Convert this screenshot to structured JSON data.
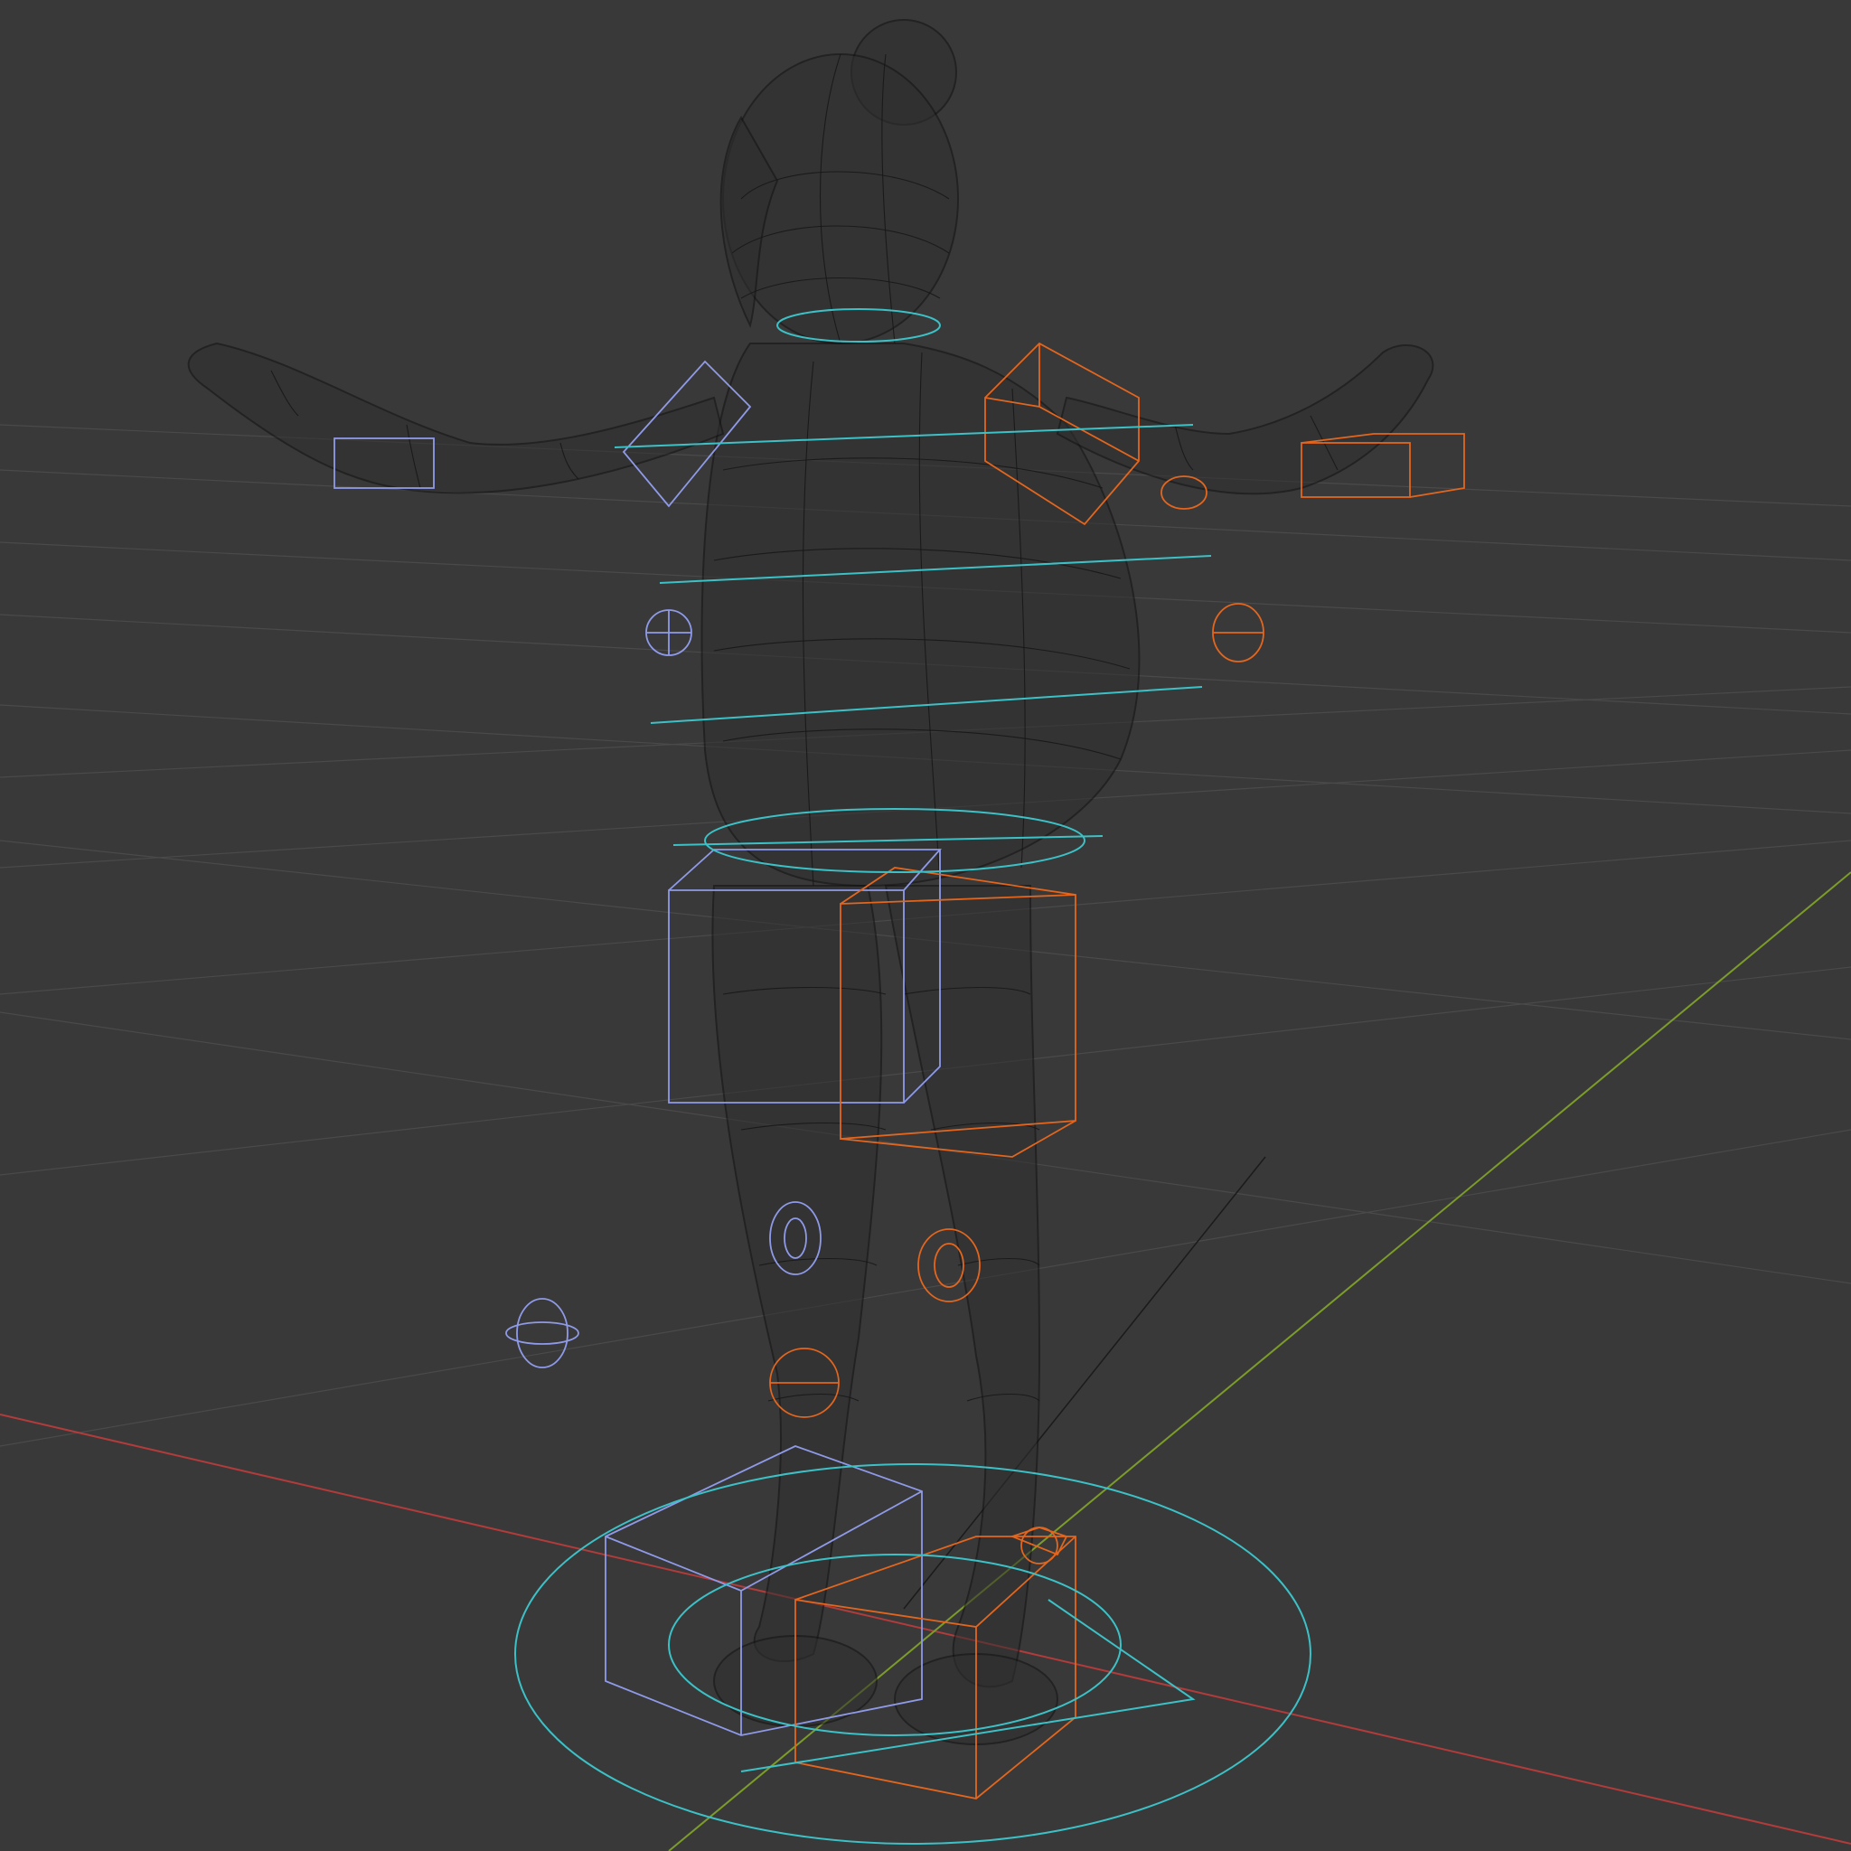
{
  "viewport": {
    "mode": "wireframe",
    "background_color": "#393939",
    "grid_color": "#4a4a4a",
    "axis_colors": {
      "x": "#b23b3b",
      "y": "#7c9c2a",
      "z": "#1b1b1b"
    },
    "rig_colors": {
      "left_side": "#8f9ae8",
      "right_side": "#e3661e",
      "center": "#3cc1c7"
    },
    "mesh_color": "#161616",
    "subject": "character-mesh-with-rig-controls"
  }
}
